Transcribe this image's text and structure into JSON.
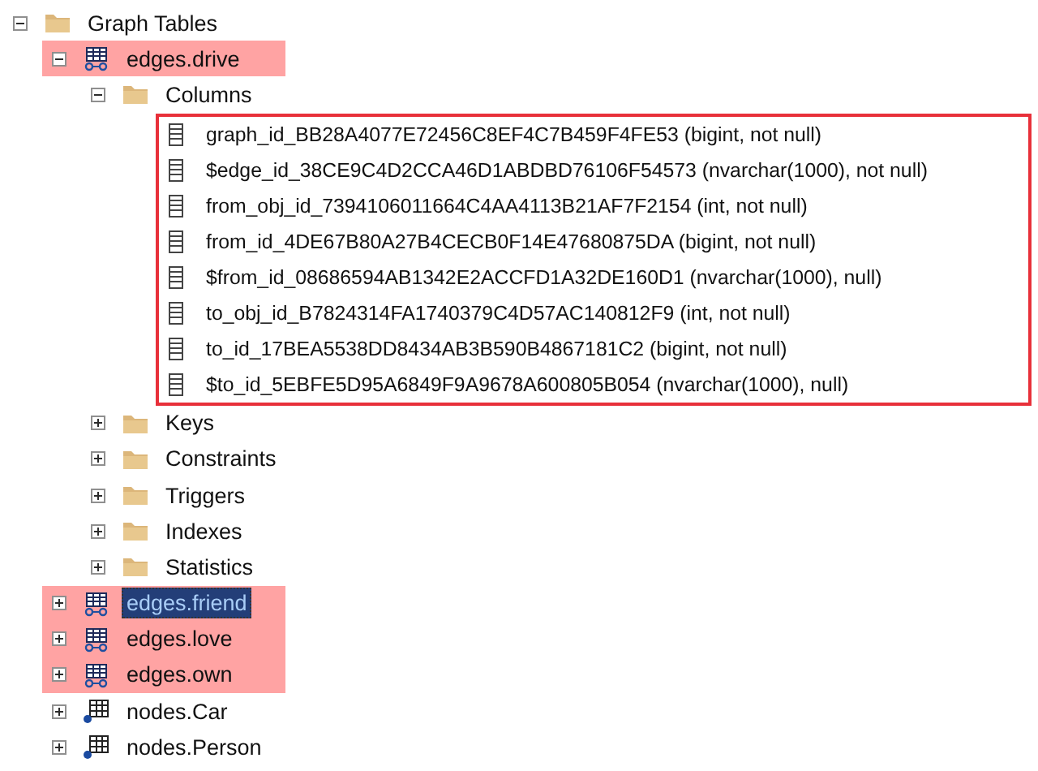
{
  "tree": [
    {
      "label": "Graph Tables",
      "kind": "folder",
      "expanded": true,
      "highlighted": false,
      "selected": false,
      "children": [
        {
          "label": "edges.drive",
          "kind": "edge_table",
          "expanded": true,
          "highlighted": true,
          "selected": false,
          "children": [
            {
              "label": "Columns",
              "kind": "folder",
              "expanded": true,
              "highlighted": false,
              "selected": false,
              "outlined": true,
              "children": [
                {
                  "label": "graph_id_BB28A4077E72456C8EF4C7B459F4FE53 (bigint, not null)",
                  "kind": "column",
                  "highlighted": false,
                  "selected": false
                },
                {
                  "label": "$edge_id_38CE9C4D2CCA46D1ABDBD76106F54573 (nvarchar(1000), not null)",
                  "kind": "column",
                  "highlighted": false,
                  "selected": false
                },
                {
                  "label": "from_obj_id_7394106011664C4AA4113B21AF7F2154 (int, not null)",
                  "kind": "column",
                  "highlighted": false,
                  "selected": false
                },
                {
                  "label": "from_id_4DE67B80A27B4CECB0F14E47680875DA (bigint, not null)",
                  "kind": "column",
                  "highlighted": false,
                  "selected": false
                },
                {
                  "label": "$from_id_08686594AB1342E2ACCFD1A32DE160D1 (nvarchar(1000), null)",
                  "kind": "column",
                  "highlighted": false,
                  "selected": false
                },
                {
                  "label": "to_obj_id_B7824314FA1740379C4D57AC140812F9 (int, not null)",
                  "kind": "column",
                  "highlighted": false,
                  "selected": false
                },
                {
                  "label": "to_id_17BEA5538DD8434AB3B590B4867181C2 (bigint, not null)",
                  "kind": "column",
                  "highlighted": false,
                  "selected": false
                },
                {
                  "label": "$to_id_5EBFE5D95A6849F9A9678A600805B054 (nvarchar(1000), null)",
                  "kind": "column",
                  "highlighted": false,
                  "selected": false
                }
              ]
            },
            {
              "label": "Keys",
              "kind": "folder",
              "expanded": false,
              "highlighted": false,
              "selected": false
            },
            {
              "label": "Constraints",
              "kind": "folder",
              "expanded": false,
              "highlighted": false,
              "selected": false
            },
            {
              "label": "Triggers",
              "kind": "folder",
              "expanded": false,
              "highlighted": false,
              "selected": false
            },
            {
              "label": "Indexes",
              "kind": "folder",
              "expanded": false,
              "highlighted": false,
              "selected": false
            },
            {
              "label": "Statistics",
              "kind": "folder",
              "expanded": false,
              "highlighted": false,
              "selected": false
            }
          ]
        },
        {
          "label": "edges.friend",
          "kind": "edge_table",
          "expanded": false,
          "highlighted": true,
          "selected": true
        },
        {
          "label": "edges.love",
          "kind": "edge_table",
          "expanded": false,
          "highlighted": true,
          "selected": false
        },
        {
          "label": "edges.own",
          "kind": "edge_table",
          "expanded": false,
          "highlighted": true,
          "selected": false
        },
        {
          "label": "nodes.Car",
          "kind": "node_table",
          "expanded": false,
          "highlighted": false,
          "selected": false
        },
        {
          "label": "nodes.Person",
          "kind": "node_table",
          "expanded": false,
          "highlighted": false,
          "selected": false
        }
      ]
    }
  ]
}
